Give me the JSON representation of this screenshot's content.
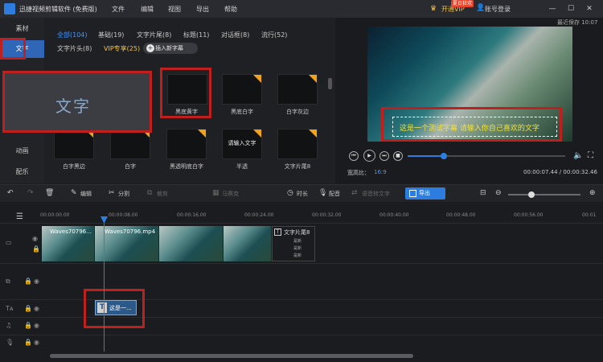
{
  "titlebar": {
    "app_title": "迅捷视频剪辑软件 (免费版)",
    "menu": [
      "文件",
      "编辑",
      "视图",
      "导出",
      "帮助"
    ],
    "vip_label": "开通VIP",
    "vip_badge": "夏日狂欢",
    "login_label": "账号登录",
    "window_controls": [
      "minimize-icon",
      "maximize-icon",
      "close-icon"
    ]
  },
  "left_tabs": [
    "素材",
    "文字",
    "动画",
    "配乐"
  ],
  "categories": {
    "row1": [
      "全部(104)",
      "基础(19)",
      "文字片尾(8)",
      "标题(11)",
      "对话框(8)",
      "流行(52)"
    ],
    "row2": [
      "文字片头(8)",
      "VIP专享(25)"
    ],
    "insert_button": "插入新字幕"
  },
  "big_preview_text": "文字",
  "thumbnails": [
    {
      "label": "黑底黄字",
      "inner": ""
    },
    {
      "label": "黑底白字",
      "inner": ""
    },
    {
      "label": "白字灰边",
      "inner": ""
    },
    {
      "label": "白字黑边",
      "inner": ""
    },
    {
      "label": "白字",
      "inner": ""
    },
    {
      "label": "黑透明底白字",
      "inner": ""
    },
    {
      "label": "半透",
      "inner": "请输入文字"
    },
    {
      "label": "文字片尾8",
      "inner": ""
    }
  ],
  "preview": {
    "autosave": "最近保存 10:07",
    "subtitle": "这是一个测试字幕 请输入你自己喜欢的文字",
    "progress": 0.23,
    "aspect_label": "宽高比：",
    "aspect_value": "16:9",
    "time": "00:00:07.44 / 00:00:32.46"
  },
  "toolbar": {
    "edit": "编辑",
    "split": "分割",
    "crop": "裁剪",
    "mosaic": "马赛克",
    "duration": "时长",
    "dub": "配音",
    "speech_to_text": "语音转文字",
    "export": "导出"
  },
  "timeline": {
    "ticks": [
      "00:00:00.00",
      "00:00:08.00",
      "00:00:16.00",
      "00:00:24.00",
      "00:00:32.00",
      "00:00:40.00",
      "00:00:48.00",
      "00:00:56.00",
      "00:01"
    ],
    "clips": {
      "video1": "Waves70796...",
      "video2": "Waves70796.mp4",
      "text_clip": "文字片尾8",
      "text_clip_lines": [
        "是新",
        "是新",
        "是新"
      ],
      "subtitle_clip": "这是一..."
    }
  }
}
